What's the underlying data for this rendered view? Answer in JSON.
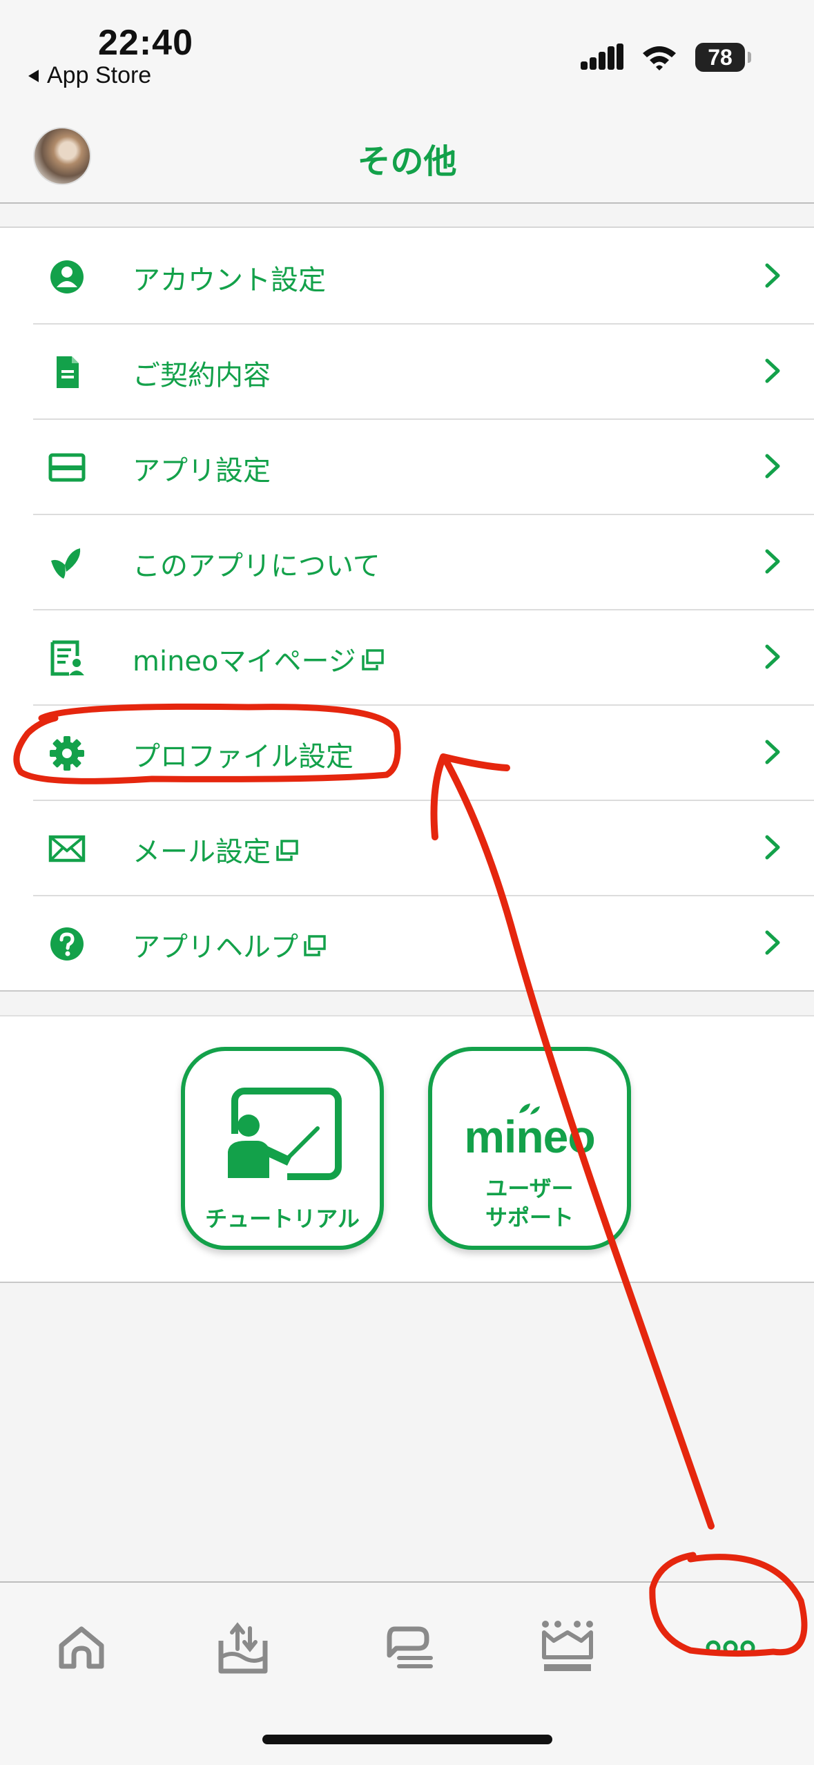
{
  "status_bar": {
    "time": "22:40",
    "back_label": "App Store",
    "battery": "78"
  },
  "header": {
    "title": "その他"
  },
  "menu": {
    "items": [
      {
        "label": "アカウント設定",
        "icon": "person-icon",
        "external": false
      },
      {
        "label": "ご契約内容",
        "icon": "document-icon",
        "external": false
      },
      {
        "label": "アプリ設定",
        "icon": "card-icon",
        "external": false
      },
      {
        "label": "このアプリについて",
        "icon": "mineo-leaf-icon",
        "external": false
      },
      {
        "label": "mineoマイページ",
        "icon": "mypage-icon",
        "external": true
      },
      {
        "label": "プロファイル設定",
        "icon": "gear-icon",
        "external": false
      },
      {
        "label": "メール設定",
        "icon": "mail-icon",
        "external": true
      },
      {
        "label": "アプリヘルプ",
        "icon": "help-icon",
        "external": true
      }
    ]
  },
  "tiles": {
    "tutorial": {
      "label": "チュートリアル"
    },
    "support": {
      "logo": "mineo",
      "line1": "ユーザー",
      "line2": "サポート"
    }
  },
  "tabbar": {
    "tabs": [
      "home-icon",
      "data-share-icon",
      "chat-icon",
      "crown-icon",
      "more-icon"
    ],
    "active": "more-icon"
  },
  "colors": {
    "accent": "#13a14a",
    "annotation": "#e5260e"
  }
}
